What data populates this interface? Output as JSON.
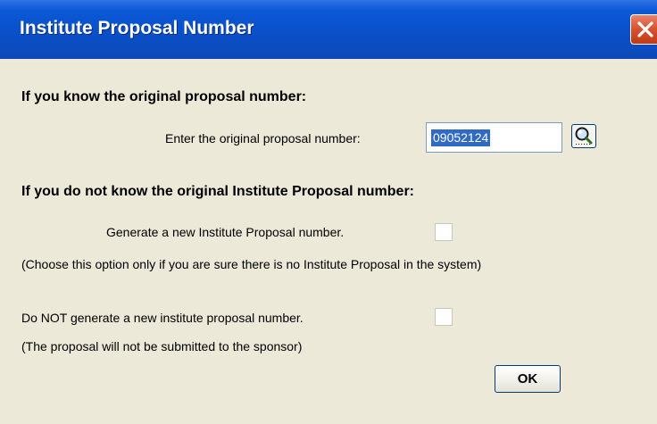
{
  "window": {
    "title": "Institute Proposal Number",
    "close_icon": "close-icon"
  },
  "section_known": {
    "heading": "If you know the original proposal number:",
    "field_label": "Enter the original proposal number:",
    "field_value": "09052124",
    "lookup_icon": "magnifier-search-icon"
  },
  "section_unknown": {
    "heading": "If you do not know the original Institute Proposal number:",
    "generate_label": "Generate a new Institute Proposal number.",
    "generate_checked": false,
    "generate_note": "(Choose this option only if  you are sure there is no Institute Proposal in the system)",
    "no_generate_label": "Do NOT generate a new institute proposal number.",
    "no_generate_checked": false,
    "no_generate_note": "(The proposal will not be submitted to the sponsor)"
  },
  "buttons": {
    "ok_label": "OK"
  },
  "colors": {
    "titlebar": "#0a4fc7",
    "close_button": "#d5512f",
    "dialog_bg": "#ece9d8",
    "selection": "#316ac5"
  }
}
